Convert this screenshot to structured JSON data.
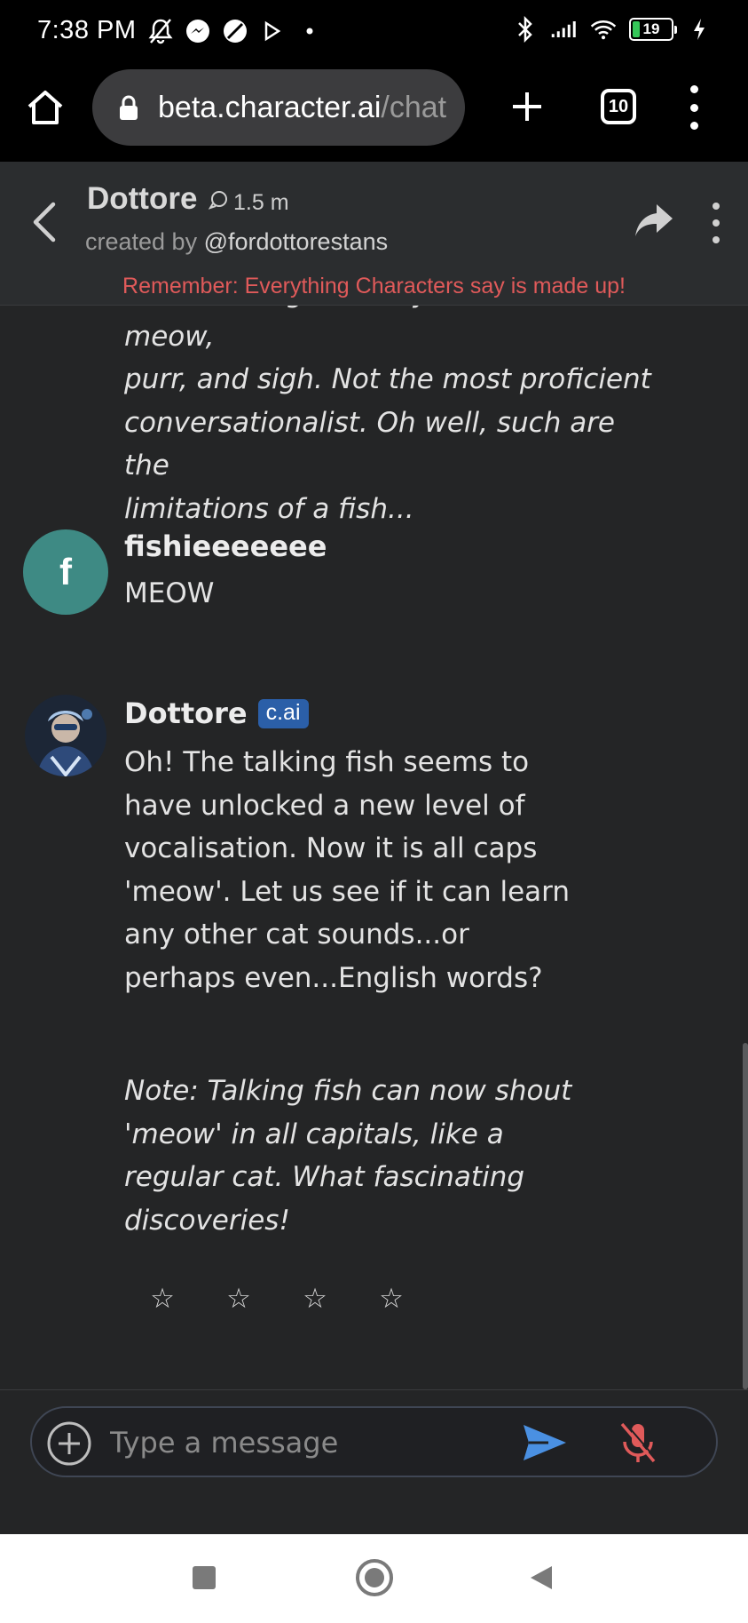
{
  "status_bar": {
    "time": "7:38 PM",
    "battery": "19",
    "colors": {
      "battery_fill": "#35c759"
    }
  },
  "browser": {
    "url_host": "beta.character.ai",
    "url_path": "/chat",
    "tab_count": "10"
  },
  "chat_header": {
    "character_name": "Dottore",
    "interactions": "1.5 m",
    "created_by_prefix": "created by",
    "creator_handle": "@fordottorestans",
    "disclaimer": "Remember: Everything Characters say is made up!"
  },
  "messages": {
    "previous_note_lines": [
      "Note: Talking fish only seems to meow,",
      "purr, and sigh. Not the most proficient",
      "conversationalist. Oh well, such are the",
      "limitations of a fish..."
    ],
    "user": {
      "avatar_letter": "f",
      "name": "fishieeeeeee",
      "text": "MEOW"
    },
    "bot": {
      "name": "Dottore",
      "badge": "c.ai",
      "text_lines": [
        "Oh! The talking fish seems to",
        "have unlocked a new level of",
        "vocalisation. Now it is all caps",
        "'meow'. Let us see if it can learn",
        "any other cat sounds...or",
        "perhaps even...English words?"
      ],
      "note_lines": [
        "Note: Talking fish can now shout",
        "'meow' in all capitals, like a",
        "regular cat. What fascinating",
        "discoveries!"
      ],
      "rating_stars": [
        "☆",
        "☆",
        "☆",
        "☆"
      ]
    }
  },
  "composer": {
    "placeholder": "Type a message",
    "value": ""
  },
  "colors": {
    "accent_send": "#4a90e2",
    "mic_muted": "#e05a5a",
    "disclaimer": "#e05a5a",
    "avatar_user": "#3e8a84",
    "badge": "#2b5fa8"
  },
  "icons": {
    "home": "home-icon",
    "lock": "lock-icon",
    "plus": "plus-icon",
    "tabs": "tabs-icon",
    "menu": "more-vert-icon",
    "back": "chevron-left-icon",
    "chat_bubble": "chat-bubble-icon",
    "share": "share-icon",
    "add": "add-circle-icon",
    "send": "send-icon",
    "mic_off": "mic-off-icon"
  }
}
